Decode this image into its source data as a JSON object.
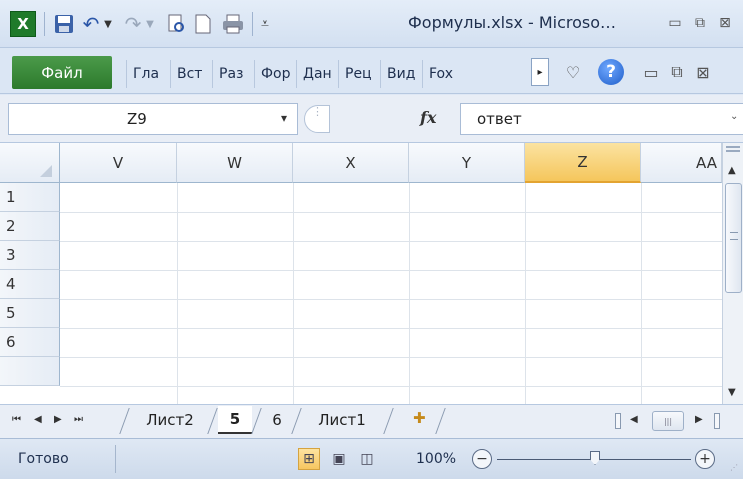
{
  "titlebar": {
    "title": "Формулы.xlsx - Microso…",
    "qat_icons": [
      "excel-logo-icon",
      "save-icon",
      "undo-icon",
      "redo-icon",
      "print-preview-icon",
      "new-icon",
      "print-icon",
      "customize-icon"
    ],
    "window_controls": [
      "minimize-icon",
      "restore-icon",
      "close-icon"
    ]
  },
  "ribbon": {
    "file_tab": "Файл",
    "tabs": [
      "Гла",
      "Вст",
      "Раз",
      "Фор",
      "Дан",
      "Рец",
      "Вид",
      "Fox"
    ],
    "more_arrow": "▸"
  },
  "formula_bar": {
    "name_box": "Z9",
    "name_box_arrow": "▾",
    "fx": "fx",
    "value": "ответ"
  },
  "grid": {
    "columns": [
      "V",
      "W",
      "X",
      "Y",
      "Z",
      "AA"
    ],
    "selected_column": "Z",
    "rows": [
      "1",
      "2",
      "3",
      "4",
      "5",
      "6"
    ]
  },
  "sheets": {
    "nav": [
      "⏮",
      "◀",
      "▶",
      "⏭"
    ],
    "tabs": [
      "Лист2",
      "5",
      "6",
      "Лист1"
    ],
    "active_tab": "5"
  },
  "status": {
    "ready": "Готово",
    "zoom": "100%",
    "zoom_level": 0.5
  },
  "colors": {
    "file_tab": "#2c7a2c",
    "selected_header": "#f5c65c"
  }
}
